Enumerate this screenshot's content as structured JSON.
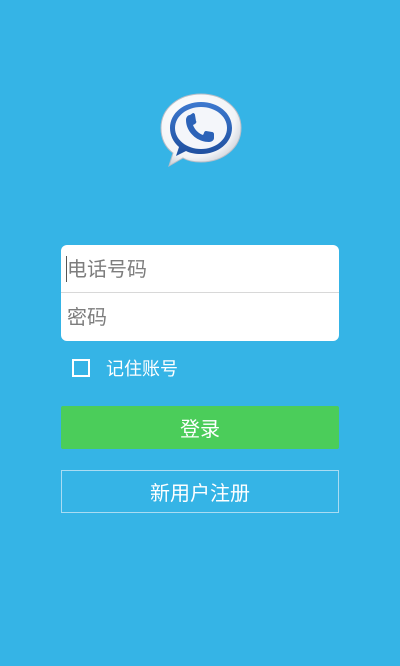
{
  "login": {
    "phone_placeholder": "电话号码",
    "password_placeholder": "密码",
    "remember_label": "记住账号",
    "remember_checked": false,
    "login_label": "登录",
    "register_label": "新用户注册"
  },
  "icons": {
    "logo": "phone-chat-bubble-icon"
  },
  "colors": {
    "background": "#35b4e6",
    "login_button": "#4bcd5a",
    "logo_blue": "#2c63b8"
  }
}
